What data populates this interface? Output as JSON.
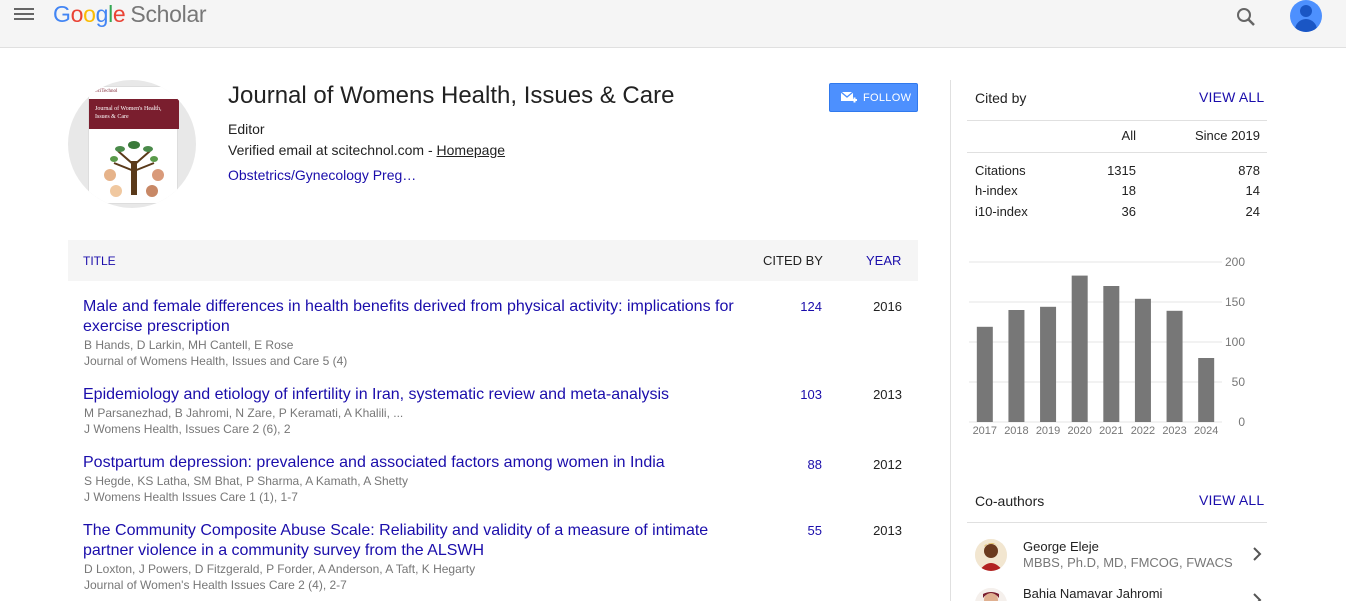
{
  "header": {
    "logo_letters": [
      "G",
      "o",
      "o",
      "g",
      "l",
      "e"
    ],
    "logo_product": "Scholar",
    "menu_icon": "menu-icon",
    "search_icon": "search-icon",
    "avatar_icon": "account-avatar-icon"
  },
  "profile": {
    "cover_publisher": "SciTechnol",
    "cover_title": "Journal of Women's Health, Issues & Care",
    "name": "Journal of Womens Health, Issues & Care",
    "affiliation": "Editor",
    "email_text": "Verified email at scitechnol.com - ",
    "homepage_label": "Homepage",
    "interest": "Obstetrics/Gynecology Preg…",
    "follow_label": "FOLLOW"
  },
  "table": {
    "col_title": "TITLE",
    "col_cited": "CITED BY",
    "col_year": "YEAR",
    "rows": [
      {
        "title": "Male and female differences in health benefits derived from physical activity: implications for exercise prescription",
        "authors": "B Hands, D Larkin, MH Cantell, E Rose",
        "venue": "Journal of Womens Health, Issues and Care 5 (4)",
        "cited": "124",
        "year": "2016"
      },
      {
        "title": "Epidemiology and etiology of infertility in Iran, systematic review and meta-analysis",
        "authors": "M Parsanezhad, B Jahromi, N Zare, P Keramati, A Khalili, ...",
        "venue": "J Womens Health, Issues Care 2 (6), 2",
        "cited": "103",
        "year": "2013"
      },
      {
        "title": "Postpartum depression: prevalence and associated factors among women in India",
        "authors": "S Hegde, KS Latha, SM Bhat, P Sharma, A Kamath, A Shetty",
        "venue": "J Womens Health Issues Care 1 (1), 1-7",
        "cited": "88",
        "year": "2012"
      },
      {
        "title": "The Community Composite Abuse Scale: Reliability and validity of a measure of intimate partner violence in a community survey from the ALSWH",
        "authors": "D Loxton, J Powers, D Fitzgerald, P Forder, A Anderson, A Taft, K Hegarty",
        "venue": "Journal of Women's Health Issues Care 2 (4), 2-7",
        "cited": "55",
        "year": "2013"
      }
    ]
  },
  "cited_by": {
    "title": "Cited by",
    "view_all": "VIEW ALL",
    "col_all": "All",
    "col_since": "Since 2019",
    "metrics": [
      {
        "label": "Citations",
        "all": "1315",
        "since": "878"
      },
      {
        "label": "h-index",
        "all": "18",
        "since": "14"
      },
      {
        "label": "i10-index",
        "all": "36",
        "since": "24"
      }
    ]
  },
  "chart_data": {
    "type": "bar",
    "categories": [
      "2017",
      "2018",
      "2019",
      "2020",
      "2021",
      "2022",
      "2023",
      "2024"
    ],
    "values": [
      119,
      140,
      144,
      183,
      170,
      154,
      139,
      80
    ],
    "ylim": [
      0,
      200
    ],
    "yticks": [
      "200",
      "150",
      "100",
      "50",
      "0"
    ],
    "ytick_values": [
      200,
      150,
      100,
      50,
      0
    ],
    "bar_color": "#777777",
    "grid": true
  },
  "coauthors": {
    "title": "Co-authors",
    "view_all": "VIEW ALL",
    "items": [
      {
        "name": "George Eleje",
        "affiliation": "MBBS, Ph.D, MD, FMCOG, FWACS"
      },
      {
        "name": "Bahia Namavar Jahromi",
        "affiliation": ""
      }
    ]
  },
  "colors": {
    "link": "#1a0dab",
    "follow_button": "#4d90fe",
    "bar": "#777777"
  }
}
